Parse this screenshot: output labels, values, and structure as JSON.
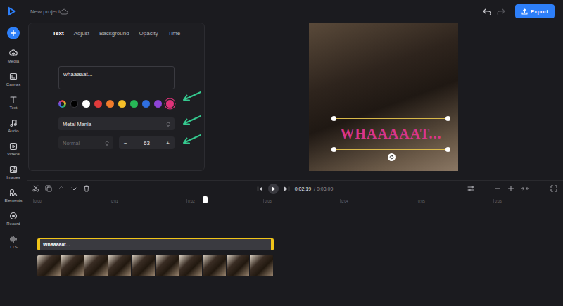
{
  "header": {
    "project_title": "New project",
    "export_label": "Export"
  },
  "sidebar": {
    "items": [
      {
        "label": "Media"
      },
      {
        "label": "Canvas"
      },
      {
        "label": "Text"
      },
      {
        "label": "Audio"
      },
      {
        "label": "Videos"
      },
      {
        "label": "Images"
      },
      {
        "label": "Elements"
      },
      {
        "label": "Record"
      },
      {
        "label": "TTS"
      }
    ]
  },
  "panel": {
    "tabs": [
      {
        "label": "Text",
        "selected": true
      },
      {
        "label": "Adjust",
        "selected": false
      },
      {
        "label": "Background",
        "selected": false
      },
      {
        "label": "Opacity",
        "selected": false
      },
      {
        "label": "Time",
        "selected": false
      }
    ],
    "text_value": "whaaaaat...",
    "colors": [
      {
        "kind": "picker",
        "selected": false
      },
      {
        "kind": "swatch",
        "color": "#000000",
        "selected": false
      },
      {
        "kind": "swatch",
        "color": "#ffffff",
        "selected": false
      },
      {
        "kind": "swatch",
        "color": "#e03b3b",
        "selected": false
      },
      {
        "kind": "swatch",
        "color": "#f07b2b",
        "selected": false
      },
      {
        "kind": "swatch",
        "color": "#f5c028",
        "selected": false
      },
      {
        "kind": "swatch",
        "color": "#27b857",
        "selected": false
      },
      {
        "kind": "swatch",
        "color": "#2f6fe0",
        "selected": false
      },
      {
        "kind": "swatch",
        "color": "#8e44d6",
        "selected": false
      },
      {
        "kind": "swatch",
        "color": "#e0337a",
        "selected": true
      }
    ],
    "font": "Metal Mania",
    "style": {
      "value": "Normal",
      "disabled": true
    },
    "size": {
      "value": "63",
      "decrement": "−",
      "increment": "+"
    }
  },
  "preview": {
    "overlay_text": "WHAAAAAT...",
    "selected": true
  },
  "timeline": {
    "current_time": "0:02.19",
    "total_time": "/ 0:03.09",
    "playhead_level": 0.709,
    "ruler": [
      "0:00",
      "0:01",
      "0:02",
      "0:03",
      "0:04",
      "0:05",
      "0:06"
    ],
    "text_clip": {
      "label": "Whaaaaat...",
      "selected": true
    }
  }
}
